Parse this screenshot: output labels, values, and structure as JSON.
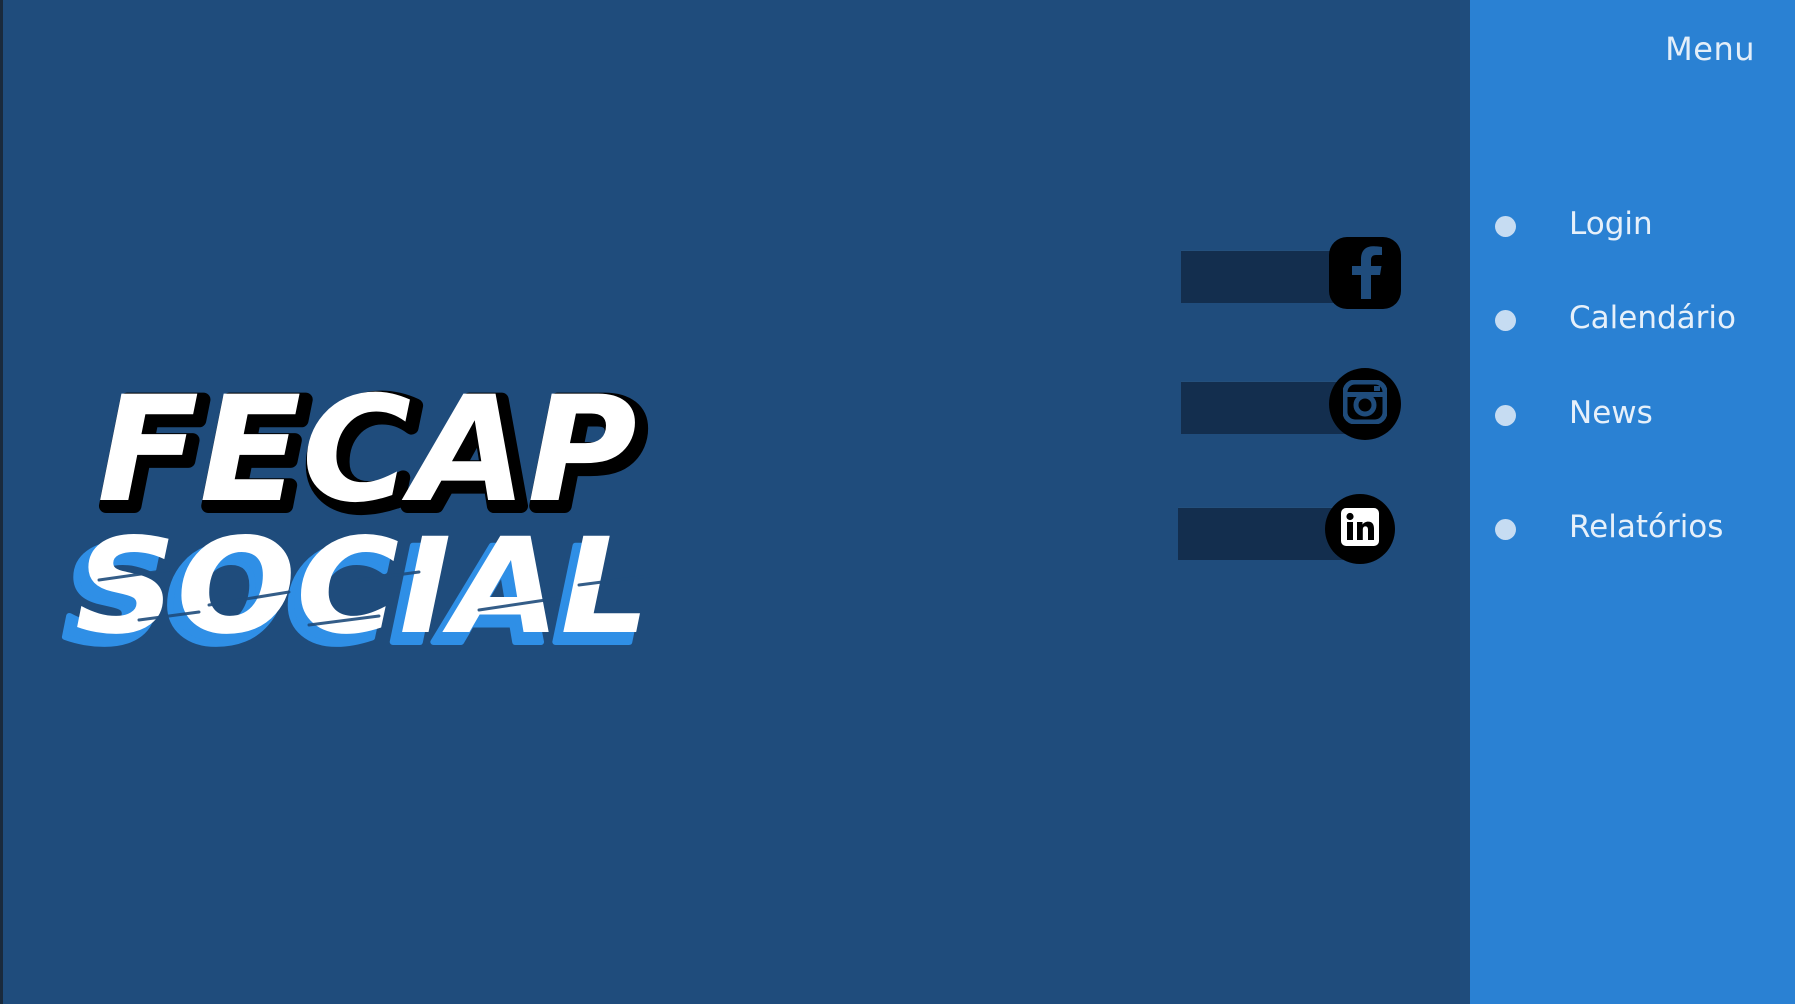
{
  "brand": {
    "line1": "FECAP",
    "line2": "SOCIAL",
    "logo_name": "fecap-social-logo"
  },
  "colors": {
    "background": "#1f4c7c",
    "menu_panel": "#2a81d3",
    "social_bar": "#132e4e",
    "badge": "#000000",
    "logo_accent": "#2f8fe6"
  },
  "social": [
    {
      "name": "facebook",
      "icon": "facebook-icon"
    },
    {
      "name": "instagram",
      "icon": "instagram-icon"
    },
    {
      "name": "linkedin",
      "icon": "linkedin-icon"
    }
  ],
  "menu": {
    "title": "Menu",
    "items": [
      {
        "label": "Login"
      },
      {
        "label": "Calendário"
      },
      {
        "label": "News"
      },
      {
        "label": "Relatórios"
      }
    ]
  }
}
